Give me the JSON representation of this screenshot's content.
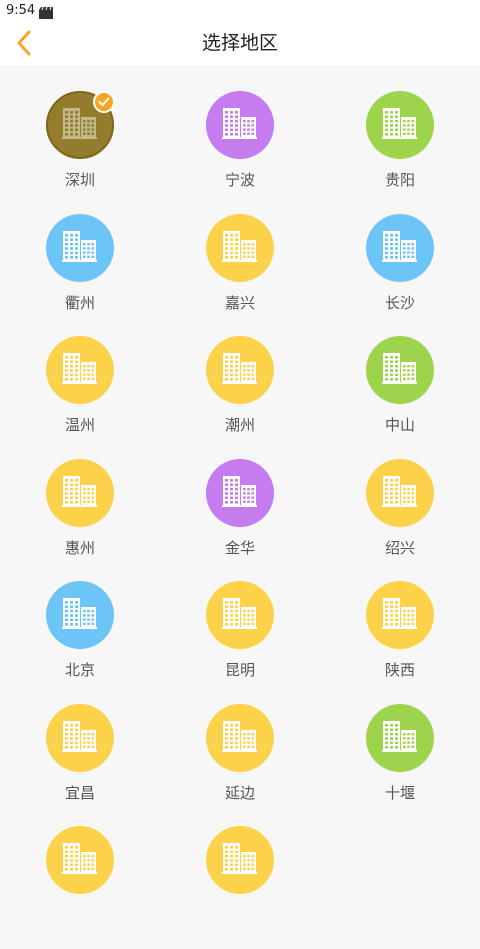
{
  "status": {
    "time": "9:54"
  },
  "header": {
    "title": "选择地区"
  },
  "colors": {
    "accent": "#f5a623",
    "yellow": "#fcd24a",
    "blue": "#6cc4f7",
    "purple": "#c57cee",
    "green": "#9ed44c",
    "selected": "#937d2d"
  },
  "regions": [
    {
      "name": "深圳",
      "color": "selected",
      "selected": true
    },
    {
      "name": "宁波",
      "color": "purple"
    },
    {
      "name": "贵阳",
      "color": "green"
    },
    {
      "name": "衢州",
      "color": "blue"
    },
    {
      "name": "嘉兴",
      "color": "yellow"
    },
    {
      "name": "长沙",
      "color": "blue"
    },
    {
      "name": "温州",
      "color": "yellow"
    },
    {
      "name": "潮州",
      "color": "yellow"
    },
    {
      "name": "中山",
      "color": "green"
    },
    {
      "name": "惠州",
      "color": "yellow"
    },
    {
      "name": "金华",
      "color": "purple"
    },
    {
      "name": "绍兴",
      "color": "yellow"
    },
    {
      "name": "北京",
      "color": "blue"
    },
    {
      "name": "昆明",
      "color": "yellow"
    },
    {
      "name": "陕西",
      "color": "yellow"
    },
    {
      "name": "宜昌",
      "color": "yellow"
    },
    {
      "name": "延边",
      "color": "yellow"
    },
    {
      "name": "十堰",
      "color": "green"
    },
    {
      "name": "",
      "color": "yellow"
    },
    {
      "name": "",
      "color": "yellow"
    }
  ]
}
